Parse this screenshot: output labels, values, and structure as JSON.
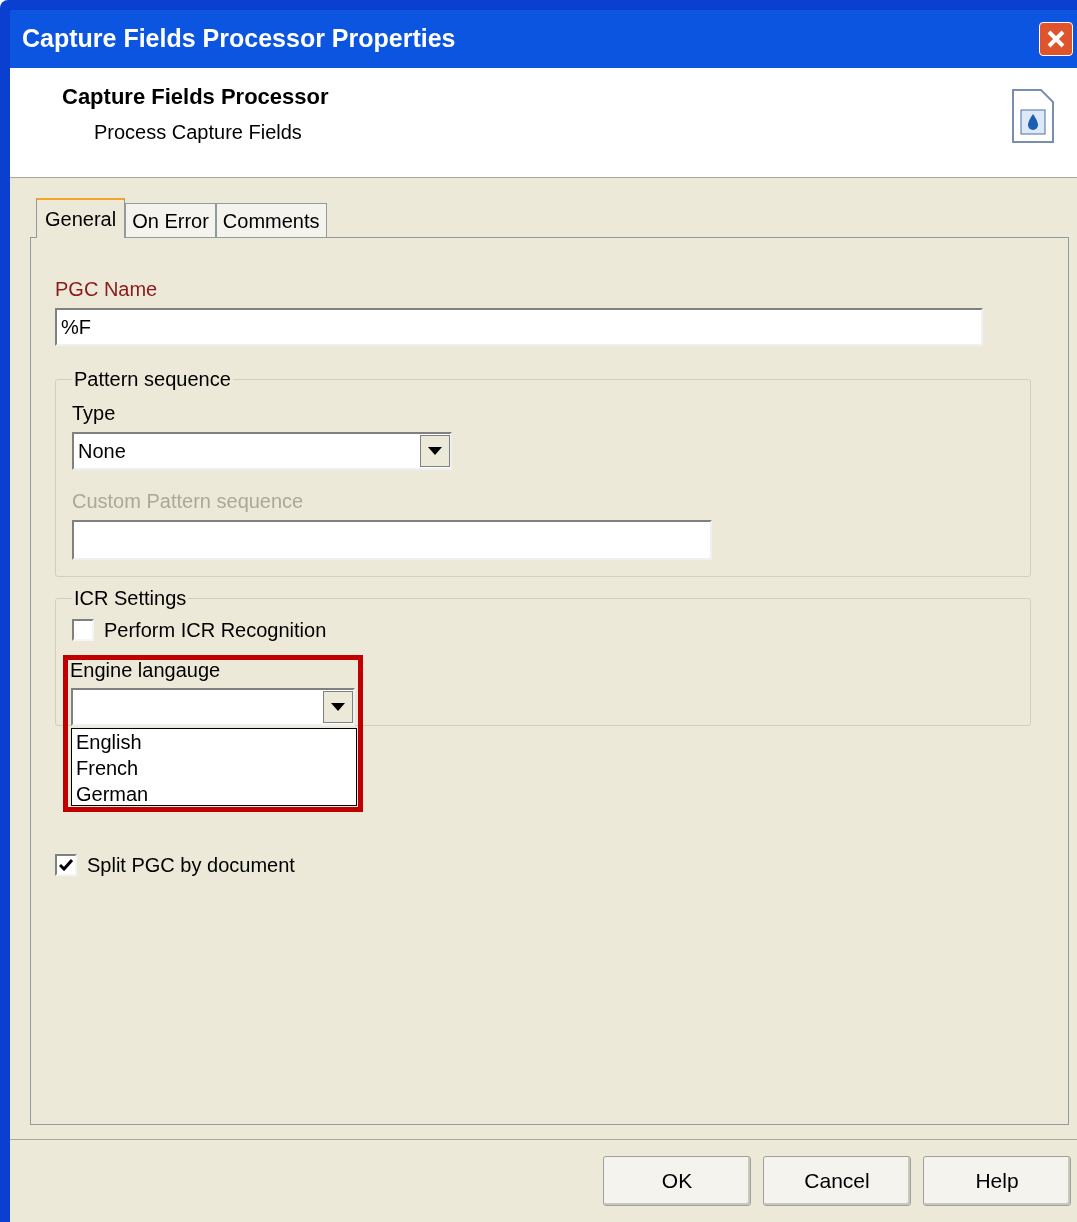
{
  "window": {
    "title": "Capture Fields Processor Properties"
  },
  "header": {
    "title": "Capture Fields Processor",
    "subtitle": "Process Capture Fields"
  },
  "tabs": [
    {
      "label": "General",
      "selected": true
    },
    {
      "label": "On Error",
      "selected": false
    },
    {
      "label": "Comments",
      "selected": false
    }
  ],
  "pgc_name": {
    "label": "PGC Name",
    "value": "%F"
  },
  "pattern_sequence": {
    "title": "Pattern sequence",
    "type_label": "Type",
    "type_value": "None",
    "custom_label": "Custom Pattern sequence",
    "custom_disabled": true
  },
  "icr_settings": {
    "title": "ICR Settings",
    "perform": {
      "label": "Perform ICR Recognition",
      "checked": false
    },
    "engine_label": "Engine langauge",
    "engine_options": [
      "English",
      "French",
      "German"
    ]
  },
  "split": {
    "label": "Split PGC by document",
    "checked": true
  },
  "buttons": [
    "OK",
    "Cancel",
    "Help"
  ]
}
